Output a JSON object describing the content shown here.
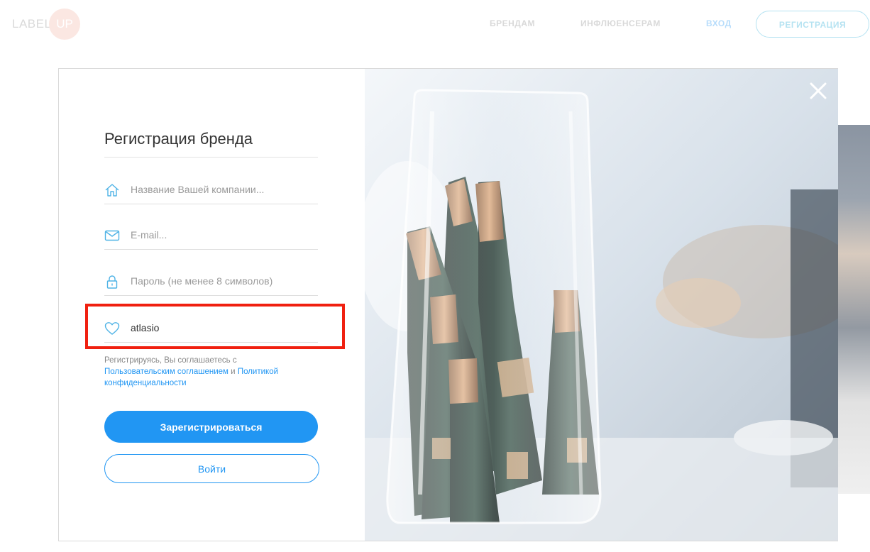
{
  "header": {
    "logo_text": "LABEL",
    "logo_badge": "UP",
    "nav": {
      "brands": "БРЕНДАМ",
      "influencers": "ИНФЛЮЕНСЕРАМ",
      "login": "ВХОД",
      "register": "РЕГИСТРАЦИЯ"
    }
  },
  "modal": {
    "title": "Регистрация бренда",
    "fields": {
      "company": {
        "placeholder": "Название Вашей компании...",
        "value": ""
      },
      "email": {
        "placeholder": "E-mail...",
        "value": ""
      },
      "password": {
        "placeholder": "Пароль (не менее 8 символов)",
        "value": ""
      },
      "promo": {
        "placeholder": "",
        "value": "atlasio"
      }
    },
    "terms": {
      "prefix": "Регистрируясь, Вы соглашаетесь с",
      "user_agreement": "Пользовательским соглашением",
      "and": "и",
      "privacy": "Политикой конфиденциальности"
    },
    "register_button": "Зарегистрироваться",
    "login_button": "Войти"
  },
  "colors": {
    "accent": "#2196f3",
    "highlight": "#f02010",
    "logo_badge": "#f3b6a7"
  },
  "icons": [
    "home-icon",
    "mail-icon",
    "lock-icon",
    "heart-icon",
    "close-icon"
  ]
}
